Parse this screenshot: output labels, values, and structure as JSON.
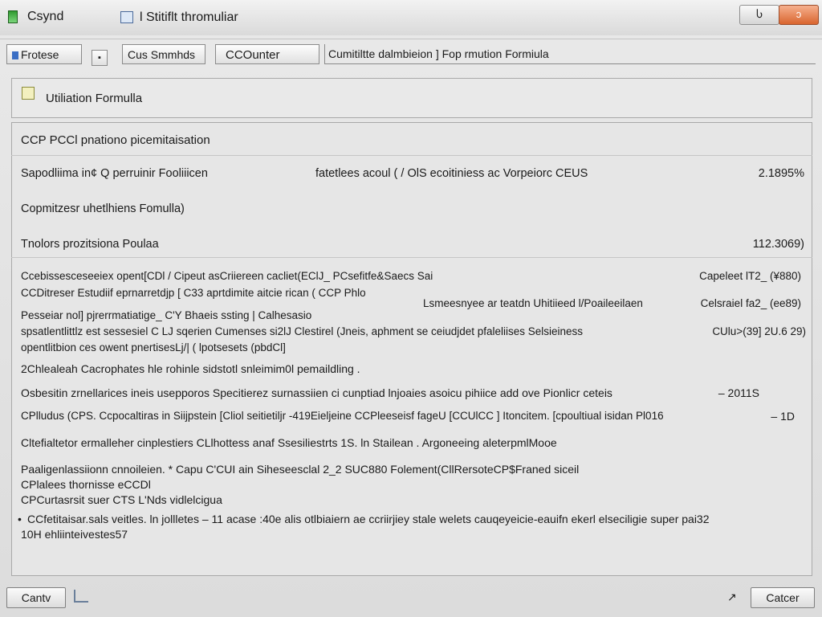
{
  "window": {
    "app_name": "Csynd",
    "title": "l Stitiflt thromuliar",
    "minimize_glyph": "Ⴑ",
    "close_glyph": "ↄ"
  },
  "toolbar": {
    "process_label": "Frotese",
    "small_button_glyph": "▪",
    "summary_label": "Cus Smmhds",
    "counter_label": "CCOunter",
    "path_label": "Cumitiltte dalmbieion ]  Fop rmution Formiula"
  },
  "header_panel": {
    "title": "Utiliation Formulla"
  },
  "content": {
    "section_title": "CCP PCCl pnationo picemitaisation",
    "row1": {
      "label": "Sapodliima in¢ Q  perruinir Fooliiicen",
      "middle": "fatetlees acoul ( / OlS ecoitiniess ac Vorpeiorc CEUS",
      "value": "2.1895%"
    },
    "row2": {
      "label": "Copmitzesr uhetlhiens Fomulla)"
    },
    "row3": {
      "label": "Tnolors prozitsiona Poulaa",
      "value": "112.3069)"
    },
    "block1": {
      "line1": "Ccebissesceseeiex opent[CDl / Cipeut asCriiereen cacliet(EClJ_ PCsefitfe&Saecs Sai",
      "line1_value": "Capeleet lT2_ (¥880)",
      "line2": "CCDitreser Estudiif eprnarretdjp [ C33 aprtdimite aitcie rican ( CCP Phlo",
      "line2_middle": "Lsmeesnyee ar teatdn Uhitiieed l/Poaileeilaen",
      "line2_value": "Celsraiel fa2_ (ee89)",
      "line3": "Pesseiar nol] pjrerrmatiatige_ C'Y Bhaeis ssting | Calhesasio",
      "line4": "spsatlentlittlz est sessesiel C LJ sqerien Cumenses si2lJ Clestirel (Jneis, aphment se ceiudjdet pfaleliises Selsieiness",
      "line4_value": "CUlu>(39] 2U.6 29)",
      "line5": "opentlitbion ces owent pnertisesLj/| ( lpotsesets (pbdCl]"
    },
    "line_a": "2Chlealeah Cacrophates hle rohinle sidstotl snleimim0l pemaildling .",
    "line_b": "Osbesitin zrnellarices ineis usepporos Specitierez surnassiien ci cunptiad lnjoaies asoicu pihiice add ove Pionlicr ceteis",
    "line_b_value": "– 2011S",
    "line_c": "CPlludus (CPS. Ccpocaltiras in Siijpstein [Cliol seitietiljr -419Eieljeine CCPleeseisf fageU [CCUlCC ] Itoncitem. [cpoultiual isidan Pl016",
    "line_c_value": "– 1D",
    "line_d": "Cltefialtetor ermalleher cinplestiers CLlhottess anaf Ssesiliestrts 1S. ln Stailean . Argoneeing aleterpmlMooe",
    "para1": "Paaligenlassiionn cnnoileien. * Capu C'CUI ain Siheseesclal 2_2 SUC880 Folement(CllRersoteCP$Franed siceil",
    "para2": "CPlalees thornisse eCCDl",
    "para3": "CPCurtasrsit suer CTS L'Nds vidlelcigua",
    "bullet_glyph": "•",
    "para4": "CCfetitaisar.sals veitles. ln jollletes –  11  acase :40e alis otlbiaiern ae ccriirjiey stale welets cauqeyeicie-eauifn ekerl elseciligie super pai32",
    "para5": "10H ehliinteivestes57"
  },
  "footer": {
    "left_button": "Cantv",
    "cursor_glyph": "↗",
    "right_button": "Catcer"
  }
}
